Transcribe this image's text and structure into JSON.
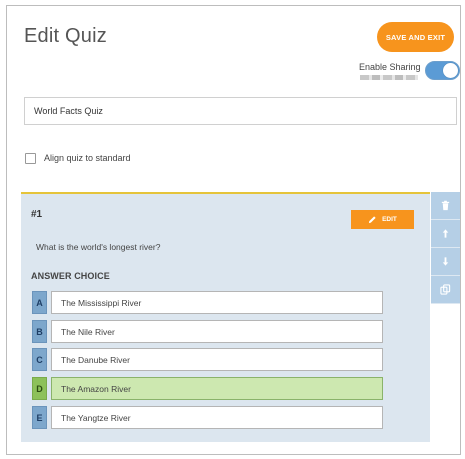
{
  "header": {
    "title": "Edit Quiz",
    "save_label": "SAVE AND EXIT"
  },
  "sharing": {
    "label": "Enable Sharing",
    "enabled": true
  },
  "quiz": {
    "title_value": "World Facts Quiz",
    "align_label": "Align quiz to standard",
    "align_checked": false
  },
  "question": {
    "number": "#1",
    "edit_label": "EDIT",
    "text": "What is the world's longest river?",
    "answer_heading": "ANSWER CHOICE",
    "answers": [
      {
        "letter": "A",
        "text": "The Mississippi River",
        "correct": false
      },
      {
        "letter": "B",
        "text": "The Nile River",
        "correct": false
      },
      {
        "letter": "C",
        "text": "The Danube River",
        "correct": false
      },
      {
        "letter": "D",
        "text": "The Amazon River",
        "correct": true
      },
      {
        "letter": "E",
        "text": "The Yangtze River",
        "correct": false
      }
    ]
  },
  "tools": [
    "trash-icon",
    "arrow-up-icon",
    "arrow-down-icon",
    "duplicate-icon"
  ],
  "colors": {
    "accent": "#f7941d",
    "toggle_on": "#5b9bd5",
    "card_bg": "#dce6ef",
    "card_border": "#e5c43a",
    "correct_bg": "#cde8b0",
    "letter_bg": "#7da7cc",
    "tool_bg": "#b5cfe6"
  }
}
